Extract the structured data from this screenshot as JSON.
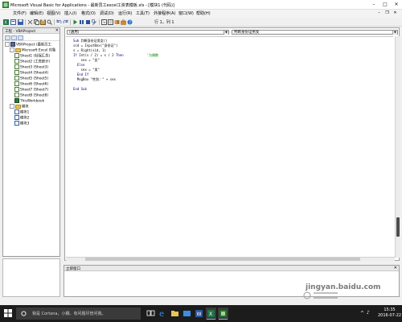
{
  "window": {
    "title": "Microsoft Visual Basic for Applications - 最新员工excel工资表模板.xls - [模块1 (代码)]"
  },
  "menubar": {
    "items": [
      "文件(F)",
      "编辑(E)",
      "视图(V)",
      "插入(I)",
      "格式(O)",
      "调试(D)",
      "运行(R)",
      "工具(T)",
      "外接程序(A)",
      "窗口(W)",
      "帮助(H)"
    ]
  },
  "toolbar": {
    "cursor_position": "行 1，列 1"
  },
  "project_pane": {
    "title": "工程 - VBAProject",
    "tree": [
      {
        "label": "VBAProject (最新员工",
        "indent": 0,
        "icon": "proj",
        "expander": "-"
      },
      {
        "label": "Microsoft Excel 对象",
        "indent": 1,
        "icon": "folder",
        "expander": "-"
      },
      {
        "label": "Sheet1 (社保汇总)",
        "indent": 2,
        "icon": "sheet"
      },
      {
        "label": "Sheet2 (工资统计)",
        "indent": 2,
        "icon": "sheet"
      },
      {
        "label": "Sheet3 (Sheet3)",
        "indent": 2,
        "icon": "sheet"
      },
      {
        "label": "Sheet4 (Sheet4)",
        "indent": 2,
        "icon": "sheet"
      },
      {
        "label": "Sheet5 (Sheet5)",
        "indent": 2,
        "icon": "sheet"
      },
      {
        "label": "Sheet6 (Sheet6)",
        "indent": 2,
        "icon": "sheet"
      },
      {
        "label": "Sheet7 (Sheet7)",
        "indent": 2,
        "icon": "sheet"
      },
      {
        "label": "Sheet8 (Sheet8)",
        "indent": 2,
        "icon": "sheet"
      },
      {
        "label": "ThisWorkbook",
        "indent": 2,
        "icon": "wb"
      },
      {
        "label": "模块",
        "indent": 1,
        "icon": "folder",
        "expander": "-"
      },
      {
        "label": "模块1",
        "indent": 2,
        "icon": "module"
      },
      {
        "label": "模块2",
        "indent": 2,
        "icon": "module"
      },
      {
        "label": "模块3",
        "indent": 2,
        "icon": "module"
      }
    ]
  },
  "code_window": {
    "object_combo": "(通用)",
    "procedure_combo": "判断身份证男女",
    "lines": [
      [
        {
          "t": "Sub ",
          "c": "kw"
        },
        {
          "t": "判断身份证男女()"
        }
      ],
      [
        {
          "t": "sid = InputBox(\"身份证\")"
        }
      ],
      [
        {
          "t": "s = Right(sid, 1)"
        }
      ],
      [
        {
          "t": "If ",
          "c": "kw"
        },
        {
          "t": "Int(s / 2) = s / 2 "
        },
        {
          "t": "Then",
          "c": "kw"
        },
        {
          "t": "            "
        },
        {
          "t": "'为偶数",
          "c": "cm"
        }
      ],
      [
        {
          "t": "    sex = \"女\""
        }
      ],
      [
        {
          "t": "  "
        },
        {
          "t": "Else",
          "c": "kw"
        }
      ],
      [
        {
          "t": "    sex = \"男\""
        }
      ],
      [
        {
          "t": "  "
        },
        {
          "t": "End If",
          "c": "kw"
        }
      ],
      [
        {
          "t": "  MsgBox \"性别：\" + sex"
        }
      ],
      [
        {
          "t": ""
        }
      ],
      [
        {
          "t": "End Sub",
          "c": "kw"
        }
      ]
    ]
  },
  "immediate_window": {
    "title": "立即窗口"
  },
  "taskbar": {
    "search_placeholder": "我是 Cortana，小娜。有问题尽管问我。",
    "time": "15:35",
    "date": "2016-07-22"
  },
  "watermark": {
    "text": "jingyan.baidu.com"
  },
  "colors": {
    "code_keyword": "#00008b",
    "code_comment": "#008000",
    "taskbar": "#1c1c1c"
  }
}
